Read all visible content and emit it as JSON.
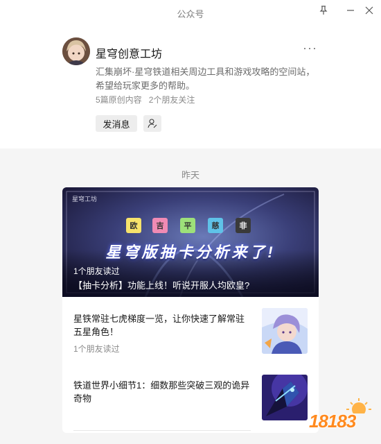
{
  "window": {
    "title": "公众号",
    "pin_icon": "pin-icon",
    "minimize_icon": "minimize-icon",
    "close_icon": "close-icon"
  },
  "account": {
    "name": "星穹创意工坊",
    "more_label": "···",
    "description": "汇集崩坏·星穹铁道相关周边工具和游戏攻略的空间站，希望给玩家更多的帮助。",
    "original_count": "5篇原创内容",
    "friends_following": "2个朋友关注",
    "message_button": "发消息",
    "follow_icon": "follow-user-icon"
  },
  "feed": {
    "day_label": "昨天",
    "lead": {
      "banner_logo": "星穹工坊",
      "dice": [
        "欧",
        "吉",
        "平",
        "慈",
        "非"
      ],
      "banner_text": "星穹版抽卡分析来了!",
      "read_note": "1个朋友读过",
      "title": "【抽卡分析】功能上线！听说开服人均欧皇?"
    },
    "items": [
      {
        "title": "星铁常驻七虎梯度一览，让你快速了解常驻五星角色！",
        "note": "1个朋友读过"
      },
      {
        "title": "铁道世界小细节1：细数那些突破三观的诡异奇物",
        "note": ""
      }
    ]
  },
  "watermark": {
    "text": "18183"
  },
  "colors": {
    "feed_bg": "#f5f5f5",
    "button_bg": "#ededed",
    "watermark": "#ff8a1f"
  }
}
